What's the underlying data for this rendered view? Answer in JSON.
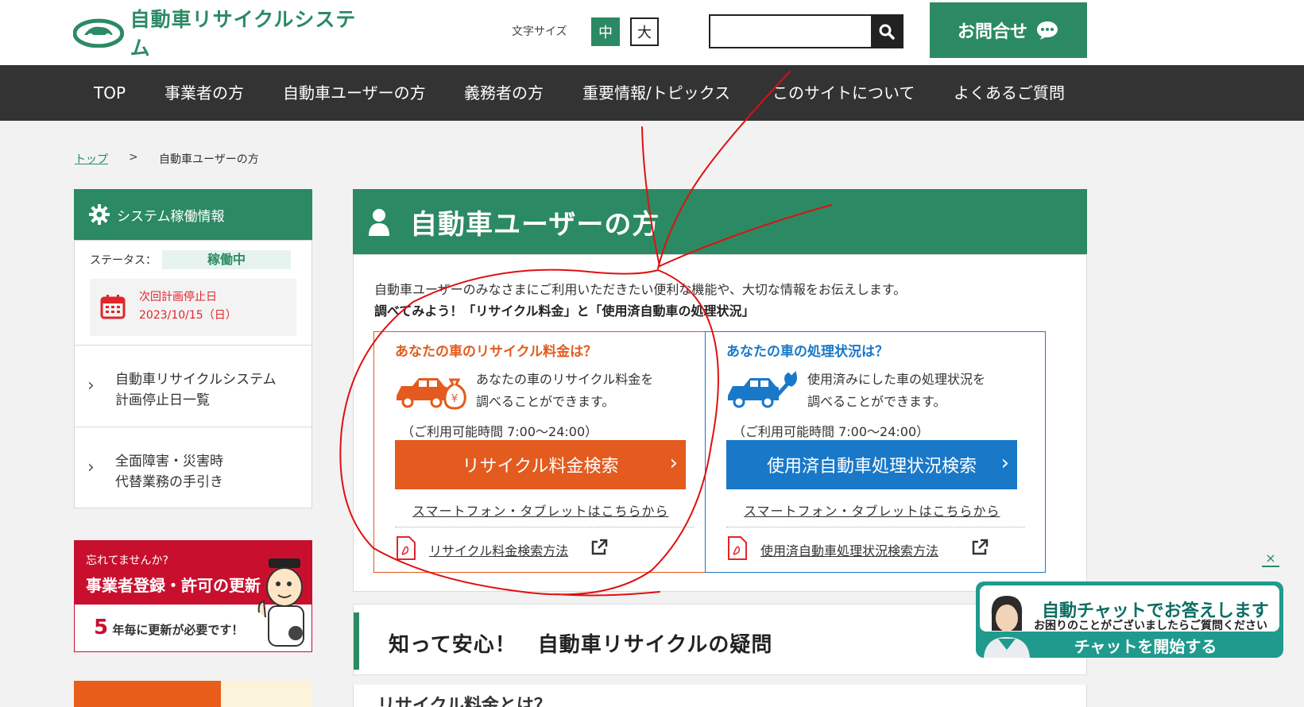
{
  "header": {
    "logo_text": "自動車リサイクルシステム",
    "font_size_label": "文字サイズ",
    "font_size_options": [
      "中",
      "大"
    ],
    "search": {
      "placeholder": "",
      "value": ""
    },
    "contact_label": "お問合せ"
  },
  "nav": {
    "items": [
      "TOP",
      "事業者の方",
      "自動車ユーザーの方",
      "義務者の方",
      "重要情報/トピックス",
      "このサイトについて",
      "よくあるご質問"
    ]
  },
  "breadcrumb": {
    "home": "トップ",
    "separator": ">",
    "current": "自動車ユーザーの方"
  },
  "sidebar": {
    "system_title": "システム稼働情報",
    "status_label": "ステータス：",
    "status_value": "稼働中",
    "next_stop_title": "次回計画停止日",
    "next_stop_date": "2023/10/15（日）",
    "links": [
      {
        "line1": "自動車リサイクルシステム",
        "line2": "計画停止日一覧"
      },
      {
        "line1": "全面障害・災害時",
        "line2": "代替業務の手引き"
      }
    ],
    "banner": {
      "line1": "忘れてませんか?",
      "line2": "事業者登録・許可の更新",
      "number": "5",
      "line3": "年毎に更新が必要です！"
    }
  },
  "main": {
    "title": "自動車ユーザーの方",
    "intro": "自動車ユーザーのみなさまにご利用いただきたい便利な機能や、大切な情報をお伝えします。",
    "intro_bold": "調べてみよう！「リサイクル料金」と「使用済自動車の処理状況」",
    "cards": [
      {
        "title": "あなたの車のリサイクル料金は？",
        "desc1": "あなたの車のリサイクル料金を",
        "desc2": "調べることができます。",
        "hours": "（ご利用可能時間 7:00〜24:00）",
        "button": "リサイクル料金検索",
        "smartphone": "スマートフォン・タブレットはこちらから",
        "guide": "リサイクル料金検索方法",
        "color": "#e35b1e"
      },
      {
        "title": "あなたの車の処理状況は？",
        "desc1": "使用済みにした車の処理状況を",
        "desc2": "調べることができます。",
        "hours": "（ご利用可能時間 7:00〜24:00）",
        "button": "使用済自動車処理状況検索",
        "smartphone": "スマートフォン・タブレットはこちらから",
        "guide": "使用済自動車処理状況検索方法",
        "color": "#1a78c8"
      }
    ]
  },
  "qa": {
    "title": "知って安心！　自動車リサイクルの疑問",
    "next_item": "リサイクル料金とは？"
  },
  "chat": {
    "close": "×",
    "title": "自動チャットでお答えします",
    "subtitle": "お困りのことがございましたらご質問ください",
    "start": "チャットを開始する"
  },
  "colors": {
    "brand_green": "#2b8a63",
    "nav_bg": "#333333",
    "alert_red": "#e0262b",
    "annotation_red": "#e01010"
  }
}
